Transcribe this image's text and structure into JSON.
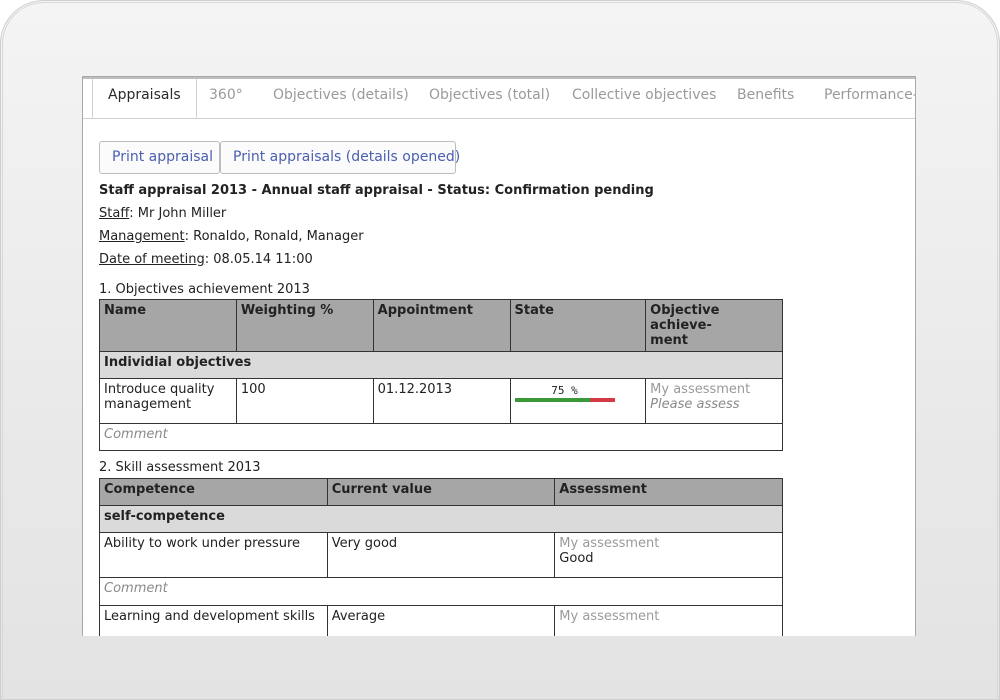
{
  "tabs": [
    {
      "label": "Appraisals",
      "active": true
    },
    {
      "label": "360°"
    },
    {
      "label": "Objectives (details)"
    },
    {
      "label": "Objectives (total)"
    },
    {
      "label": "Collective objectives"
    },
    {
      "label": "Benefits"
    },
    {
      "label": "Performance-"
    }
  ],
  "buttons": {
    "print_appraisal": "Print appraisal",
    "print_appraisals_details": "Print appraisals (details opened)"
  },
  "header": {
    "title": "Staff appraisal 2013 - Annual staff appraisal - Status: Confirmation pending",
    "staff_label": "Staff",
    "staff_value": ": Mr John Miller",
    "management_label": "Management",
    "management_value": ": Ronaldo, Ronald, Manager",
    "meeting_label": "Date of meeting",
    "meeting_value": ": 08.05.14 11:00"
  },
  "objectives": {
    "section_title": "1. Objectives achievement 2013",
    "columns": [
      "Name",
      "Weighting %",
      "Appointment",
      "State",
      "Objective achieve-\nment"
    ],
    "group": "Individial objectives",
    "row": {
      "name": "Introduce quality management",
      "weighting": "100",
      "appointment": "01.12.2013",
      "state_label": "75 %",
      "state_progress": 0.75,
      "assessment_label": "My assessment",
      "assessment_value": "Please assess"
    },
    "comment": "Comment"
  },
  "skills": {
    "section_title": "2. Skill assessment 2013",
    "columns": [
      "Competence",
      "Current value",
      "Assessment"
    ],
    "group": "self-competence",
    "rows": [
      {
        "competence": "Ability to work under pressure",
        "current": "Very good",
        "assessment_label": "My assessment",
        "assessment_value": "Good"
      },
      {
        "competence": "Learning and development skills",
        "current": "Average",
        "assessment_label": "My assessment",
        "assessment_value": ""
      }
    ],
    "comment": "Comment"
  },
  "colors": {
    "link": "#4a5fb0",
    "header_bg": "#a6a6a6",
    "group_bg": "#dadada",
    "progress_good": "#3a9a3a",
    "progress_rest": "#d23a4a"
  }
}
